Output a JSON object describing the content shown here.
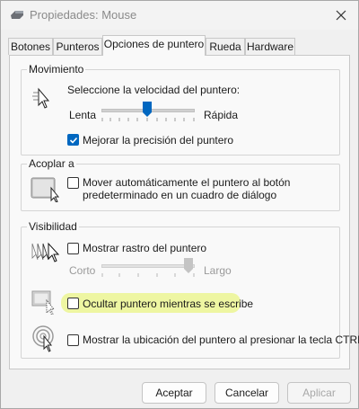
{
  "window": {
    "title": "Propiedades: Mouse"
  },
  "tabs": [
    {
      "label": "Botones"
    },
    {
      "label": "Punteros"
    },
    {
      "label": "Opciones de puntero"
    },
    {
      "label": "Rueda"
    },
    {
      "label": "Hardware"
    }
  ],
  "active_tab": "Opciones de puntero",
  "movimiento": {
    "title": "Movimiento",
    "speed_label": "Seleccione la velocidad del puntero:",
    "slow_label": "Lenta",
    "fast_label": "Rápida",
    "speed_value": 0.5,
    "precision_label": "Mejorar la precisión del puntero",
    "precision_checked": true
  },
  "acoplar": {
    "title": "Acoplar a",
    "snap_label_line1": "Mover automáticamente el puntero al botón",
    "snap_label_line2": "predeterminado en un cuadro de diálogo",
    "snap_checked": false
  },
  "visibilidad": {
    "title": "Visibilidad",
    "trails_label": "Mostrar rastro del puntero",
    "trails_checked": false,
    "short_label": "Corto",
    "long_label": "Largo",
    "trail_length_value": 1.0,
    "hide_label": "Ocultar puntero mientras se escribe",
    "hide_checked": false,
    "show_location_label": "Mostrar la ubicación del puntero al presionar la tecla CTRL",
    "show_location_checked": false
  },
  "buttons": {
    "ok": "Aceptar",
    "cancel": "Cancelar",
    "apply": "Aplicar"
  },
  "colors": {
    "accent": "#0067c0",
    "highlight": "#eef6a2"
  }
}
